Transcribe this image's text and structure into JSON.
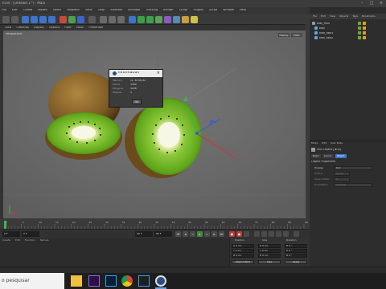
{
  "app": {
    "title": "R19) - [Untitled 1 *] - Main",
    "window_controls": [
      "–",
      "□",
      "×"
    ]
  },
  "menubar": [
    "File",
    "Edit",
    "Create",
    "Modes",
    "Select",
    "Mograph",
    "Tools",
    "Snap",
    "Animate",
    "Simulate",
    "Tracking",
    "Render",
    "Sculpt",
    "Motion Tracker",
    "MoGraph",
    "Character",
    "Pipeline",
    "Plugins",
    "V-Ray",
    "Script",
    "Window",
    "Help"
  ],
  "viewport": {
    "menu": [
      "View",
      "Cameras",
      "Display",
      "Options",
      "Filter",
      "Panel",
      "ProRender"
    ],
    "camera": "Perspective",
    "buttons": [
      "Display",
      "Filter"
    ]
  },
  "info_dialog": {
    "title": "Information",
    "rows": [
      {
        "key": "Memory",
        "value": "ca. 30 Kbyte"
      },
      {
        "key": "Points",
        "value": "3480"
      },
      {
        "key": "Polygons",
        "value": "4908"
      },
      {
        "key": "Objects",
        "value": "4"
      }
    ],
    "ok_label": "OK"
  },
  "timeline": {
    "ticks": [
      "0",
      "5",
      "10",
      "15",
      "20",
      "25",
      "30",
      "35",
      "40",
      "45",
      "50",
      "55",
      "60",
      "65",
      "70",
      "75",
      "80",
      "85",
      "90"
    ],
    "frame_start": "0 F",
    "frame_current": "0 F",
    "frame_end": "90 F",
    "frame_end2": "90 F"
  },
  "materials": {
    "menu": [
      "Create",
      "Edit",
      "Function",
      "Texture"
    ]
  },
  "coords": {
    "headers": [
      "Position",
      "Size",
      "Rotation"
    ],
    "rows": [
      {
        "pos": "X  0 cm",
        "size": "X  0 cm",
        "rot": "H  0 °"
      },
      {
        "pos": "Y  0 cm",
        "size": "Y  0 cm",
        "rot": "P  0 °"
      },
      {
        "pos": "Z  0 cm",
        "size": "Z  0 cm",
        "rot": "B  0 °"
      }
    ],
    "mode": "Object (Rel)",
    "size_mode": "Size",
    "apply": "Apply"
  },
  "object_manager": {
    "tabs": [
      "File",
      "Edit",
      "View",
      "Objects",
      "Tags",
      "Bookmarks"
    ],
    "objects": [
      {
        "name": "kiwi_fruit",
        "color": "#e0e0e0"
      },
      {
        "name": "kiwi",
        "color": "#e0e0e0"
      },
      {
        "name": "kiwi_half1",
        "color": "#e0e0e0"
      },
      {
        "name": "kiwi_half2",
        "color": "#e0e0e0"
      }
    ]
  },
  "attribute_manager": {
    "menu": [
      "Mode",
      "Edit",
      "User Data"
    ],
    "object_label": "Null Object [Null]",
    "tabs": [
      "Basic",
      "Coord.",
      "Object"
    ],
    "section": "Object Properties",
    "fields": [
      {
        "label": "Display",
        "value": "Dot"
      },
      {
        "label": "Radius",
        "value": "10 cm"
      },
      {
        "label": "Aspect Ratio",
        "value": "1"
      },
      {
        "label": "Orientation",
        "value": "Camera"
      }
    ]
  },
  "taskbar": {
    "search_placeholder": "o pesquisar",
    "apps": [
      "file-explorer-icon",
      "after-effects-icon",
      "photoshop-icon",
      "chrome-icon",
      "vscode-icon",
      "cinema4d-icon"
    ]
  },
  "colors": {
    "accent_red": "#c23a3a",
    "axis_green": "#3db54a",
    "axis_blue": "#2e5bd6",
    "kiwi_green": "#6bb81f"
  }
}
